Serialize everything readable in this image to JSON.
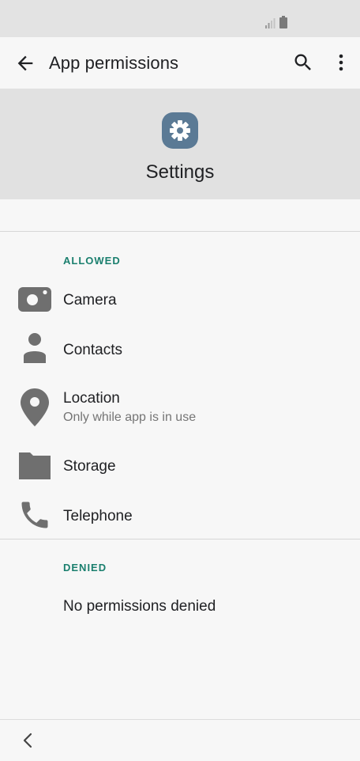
{
  "app_bar": {
    "title": "App permissions",
    "back_icon": "arrow-back-icon",
    "search_icon": "search-icon",
    "more_icon": "more-vert-icon"
  },
  "app_header": {
    "name": "Settings",
    "icon": "settings-gear-icon",
    "icon_color": "#5b7a95"
  },
  "allowed": {
    "label": "ALLOWED",
    "items": [
      {
        "label": "Camera",
        "icon": "camera-icon"
      },
      {
        "label": "Contacts",
        "icon": "person-icon"
      },
      {
        "label": "Location",
        "subtitle": "Only while app is in use",
        "icon": "location-pin-icon"
      },
      {
        "label": "Storage",
        "icon": "folder-icon"
      },
      {
        "label": "Telephone",
        "icon": "phone-icon"
      }
    ]
  },
  "denied": {
    "label": "DENIED",
    "empty_text": "No permissions denied"
  },
  "colors": {
    "accent": "#1a7f6e",
    "icon_gray": "#6f6f6f"
  }
}
